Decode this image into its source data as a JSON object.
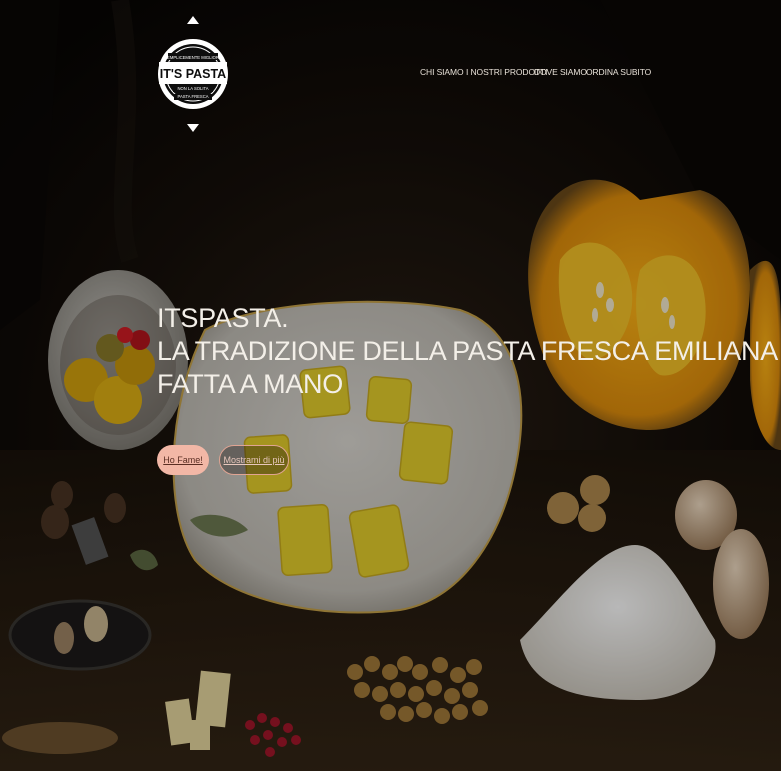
{
  "brand": {
    "logo_text": "IT'S PASTA",
    "tagline_top": "SEMPLICEMENTE MIGLIORE",
    "tagline_mid": "NON LA SOLITA",
    "tagline_bottom": "PASTA FRESCA"
  },
  "nav": {
    "items": [
      {
        "label": "CHI SIAMO"
      },
      {
        "label": "I NOSTRI PRODOTTI"
      },
      {
        "label": "DOVE SIAMO"
      },
      {
        "label": "ORDINA SUBITO"
      }
    ]
  },
  "hero": {
    "line1": "ITSPASTA.",
    "line2": "LA TRADIZIONE DELLA PASTA FRESCA EMILIANA",
    "line3": "FATTA A MANO",
    "primary_button": "Ho Fame!",
    "secondary_button": "Mostrami di più"
  },
  "colors": {
    "primary_button_bg": "#f2b7a6",
    "secondary_button_border": "#e0a493",
    "background": "#0c0906"
  }
}
